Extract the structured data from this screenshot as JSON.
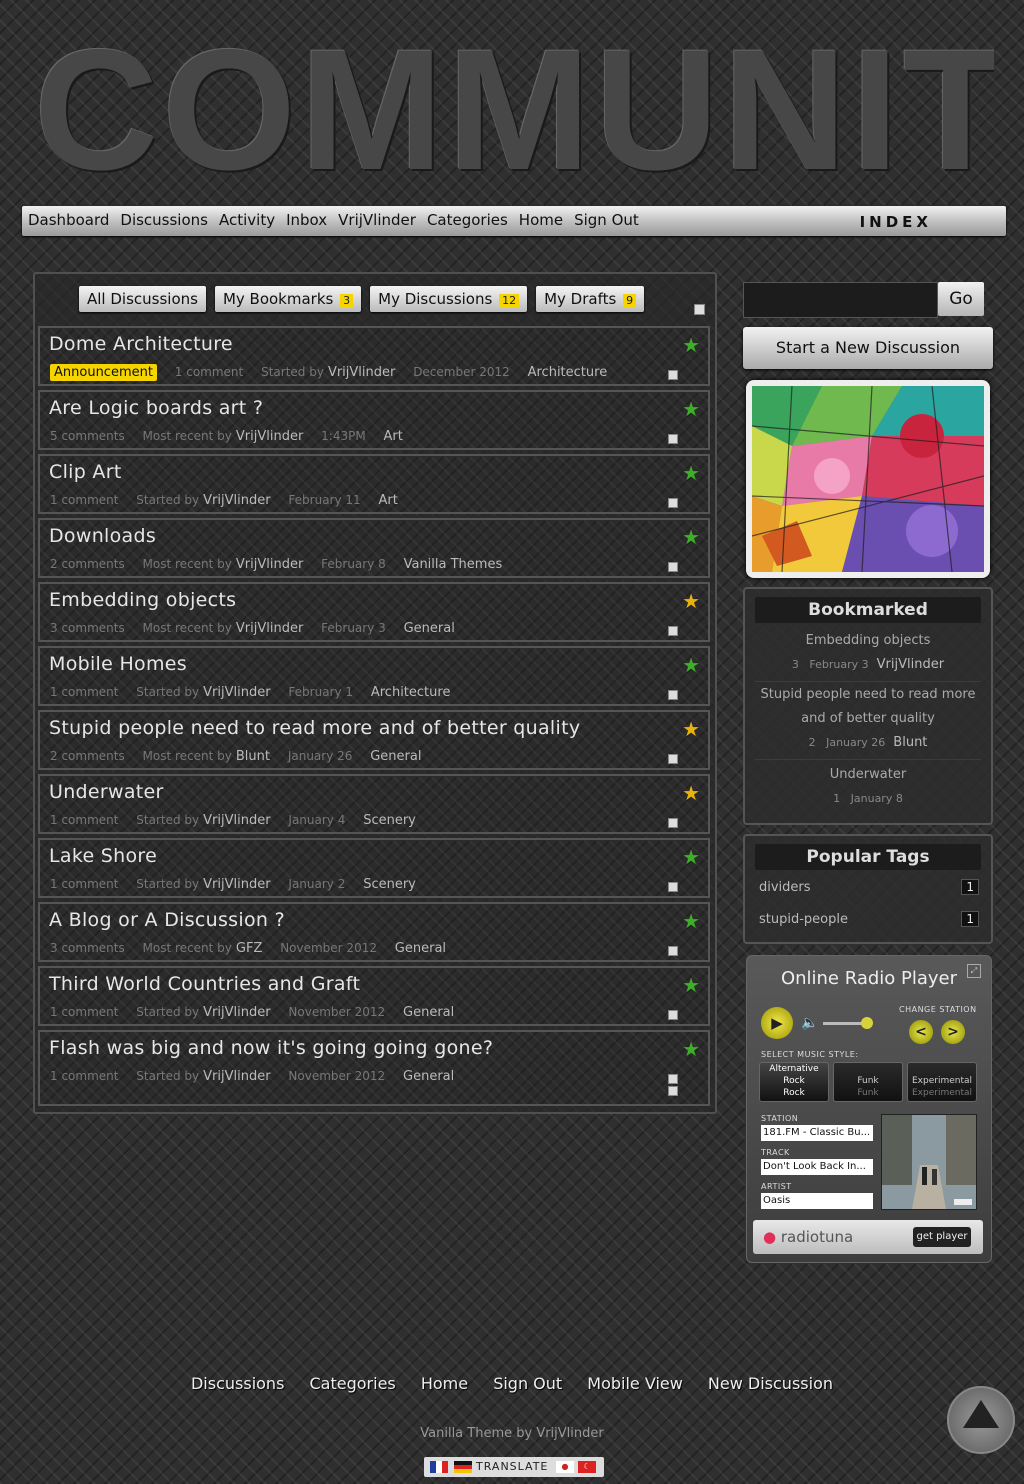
{
  "site": {
    "logo_text": "COMMUNITY"
  },
  "topnav": {
    "links": [
      "Dashboard",
      "Discussions",
      "Activity",
      "Inbox",
      "VrijVlinder",
      "Categories",
      "Home",
      "Sign Out"
    ],
    "index_label": "INDEX"
  },
  "tabs": [
    {
      "label": "All Discussions",
      "count": ""
    },
    {
      "label": "My Bookmarks",
      "count": "3"
    },
    {
      "label": "My Discussions",
      "count": "12"
    },
    {
      "label": "My Drafts",
      "count": "9"
    }
  ],
  "discussions": [
    {
      "title": "Dome Architecture",
      "badge": "Announcement",
      "comments": "1 comment",
      "by_label": "Started by",
      "user": "VrijVlinder",
      "date": "December 2012",
      "category": "Architecture",
      "star": "green"
    },
    {
      "title": "Are Logic boards art ?",
      "comments": "5 comments",
      "by_label": "Most recent by",
      "user": "VrijVlinder",
      "date": "1:43PM",
      "category": "Art",
      "star": "green"
    },
    {
      "title": "Clip Art",
      "comments": "1 comment",
      "by_label": "Started by",
      "user": "VrijVlinder",
      "date": "February 11",
      "category": "Art",
      "star": "green"
    },
    {
      "title": "Downloads",
      "comments": "2 comments",
      "by_label": "Most recent by",
      "user": "VrijVlinder",
      "date": "February 8",
      "category": "Vanilla Themes",
      "star": "green"
    },
    {
      "title": "Embedding objects",
      "comments": "3 comments",
      "by_label": "Most recent by",
      "user": "VrijVlinder",
      "date": "February 3",
      "category": "General",
      "star": "gold"
    },
    {
      "title": "Mobile Homes",
      "comments": "1 comment",
      "by_label": "Started by",
      "user": "VrijVlinder",
      "date": "February 1",
      "category": "Architecture",
      "star": "green"
    },
    {
      "title": "Stupid people need to read more and of better quality",
      "comments": "2 comments",
      "by_label": "Most recent by",
      "user": "Blunt",
      "date": "January 26",
      "category": "General",
      "star": "gold"
    },
    {
      "title": "Underwater",
      "comments": "1 comment",
      "by_label": "Started by",
      "user": "VrijVlinder",
      "date": "January 4",
      "category": "Scenery",
      "star": "gold"
    },
    {
      "title": "Lake Shore",
      "comments": "1 comment",
      "by_label": "Started by",
      "user": "VrijVlinder",
      "date": "January 2",
      "category": "Scenery",
      "star": "green"
    },
    {
      "title": "A Blog or A Discussion ?",
      "comments": "3 comments",
      "by_label": "Most recent by",
      "user": "GFZ",
      "date": "November 2012",
      "category": "General",
      "star": "green"
    },
    {
      "title": "Third World Countries and Graft",
      "comments": "1 comment",
      "by_label": "Started by",
      "user": "VrijVlinder",
      "date": "November 2012",
      "category": "General",
      "star": "green"
    },
    {
      "title": "Flash was big and now it's going going gone?",
      "comments": "1 comment",
      "by_label": "Started by",
      "user": "VrijVlinder",
      "date": "November 2012",
      "category": "General",
      "star": "green"
    }
  ],
  "sidebar": {
    "search_button": "Go",
    "start_button": "Start a New Discussion",
    "bookmarked": {
      "title": "Bookmarked",
      "items": [
        {
          "title": "Embedding objects",
          "count": "3",
          "date": "February 3",
          "user": "VrijVlinder"
        },
        {
          "title": "Stupid people need to read more and of better quality",
          "count": "2",
          "date": "January 26",
          "user": "Blunt"
        },
        {
          "title": "Underwater",
          "count": "1",
          "date": "January 8",
          "user": ""
        }
      ]
    },
    "popular_tags": {
      "title": "Popular Tags",
      "tags": [
        {
          "name": "dividers",
          "count": "1"
        },
        {
          "name": "stupid-people",
          "count": "1"
        }
      ]
    },
    "radio": {
      "title": "Online Radio Player",
      "change_station": "CHANGE STATION",
      "select_style": "SELECT MUSIC STYLE:",
      "styles": [
        [
          "Alternative",
          "Rock",
          "Rock"
        ],
        [
          "",
          "Funk",
          "Funk"
        ],
        [
          "",
          "Experimental",
          "Experimental"
        ]
      ],
      "station_label": "STATION",
      "station": "181.FM - Classic Bu...",
      "track_label": "TRACK",
      "track": "Don't Look Back In...",
      "artist_label": "ARTIST",
      "artist": "Oasis",
      "brand": "radiotuna",
      "get_player": "get player"
    }
  },
  "footer": {
    "links": [
      "Discussions",
      "Categories",
      "Home",
      "Sign Out",
      "Mobile View",
      "New Discussion"
    ],
    "credit": "Vanilla Theme by VrijVlinder",
    "translate": "TRANSLATE"
  }
}
